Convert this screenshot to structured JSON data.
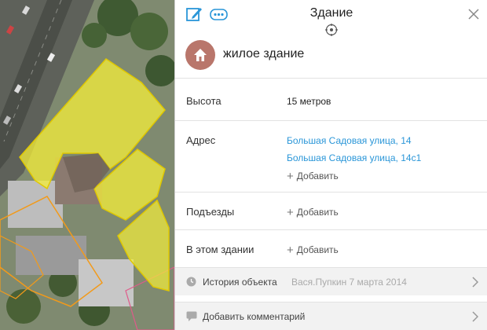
{
  "header": {
    "title": "Здание",
    "edit_icon": "edit-icon",
    "more_icon": "more-icon",
    "close_icon": "close-icon",
    "locate_icon": "locate-icon"
  },
  "building": {
    "type_label": "жилое здание",
    "type_icon": "house-icon",
    "icon_bg": "#b9766b"
  },
  "fields": {
    "height": {
      "label": "Высота",
      "value": "15 метров"
    },
    "address": {
      "label": "Адрес",
      "links": [
        "Большая Садовая улица, 14",
        "Большая Садовая улица, 14с1"
      ],
      "add_label": "Добавить"
    },
    "entrances": {
      "label": "Подъезды",
      "add_label": "Добавить"
    },
    "in_building": {
      "label": "В этом здании",
      "add_label": "Добавить"
    }
  },
  "footer": {
    "history": {
      "label": "История объекта",
      "meta": "Вася.Пупкин 7 марта 2014",
      "icon": "clock-icon"
    },
    "comment": {
      "label": "Добавить комментарий",
      "icon": "comment-icon"
    }
  },
  "colors": {
    "link": "#2a96d8",
    "building_highlight": "#f5ef3a",
    "building_outline": "#e0c800",
    "neighbour_outline": "#f29a1a"
  }
}
